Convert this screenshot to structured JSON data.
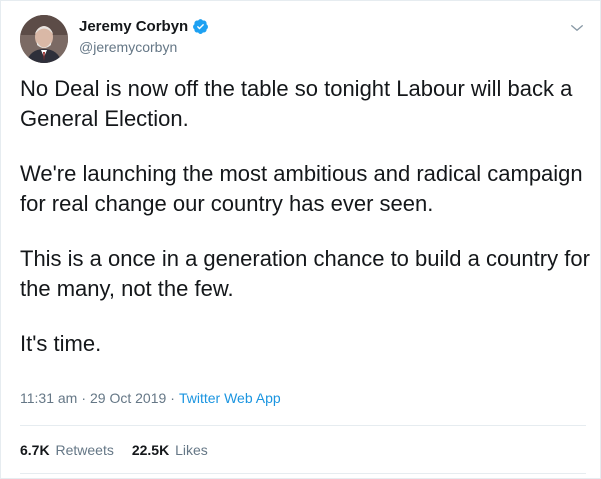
{
  "author": {
    "display_name": "Jeremy Corbyn",
    "handle": "@jeremycorbyn",
    "verified_icon": "verified-badge-icon",
    "avatar_icon": "profile-photo"
  },
  "tweet": {
    "paragraphs": [
      "No Deal is now off the table so tonight Labour will back a General Election.",
      "We're launching the most ambitious and radical campaign for real change our country has ever seen.",
      "This is a once in a generation chance to build a country for the many, not the few.",
      "It's time."
    ],
    "time": "11:31 am",
    "date": "29 Oct 2019",
    "separator": "·",
    "source": "Twitter Web App"
  },
  "stats": {
    "retweets_count": "6.7K",
    "retweets_label": "Retweets",
    "likes_count": "22.5K",
    "likes_label": "Likes"
  },
  "colors": {
    "text": "#14171a",
    "secondary": "#657786",
    "link": "#1b95e0",
    "verified": "#1da1f2",
    "divider": "#e6ecf0"
  }
}
